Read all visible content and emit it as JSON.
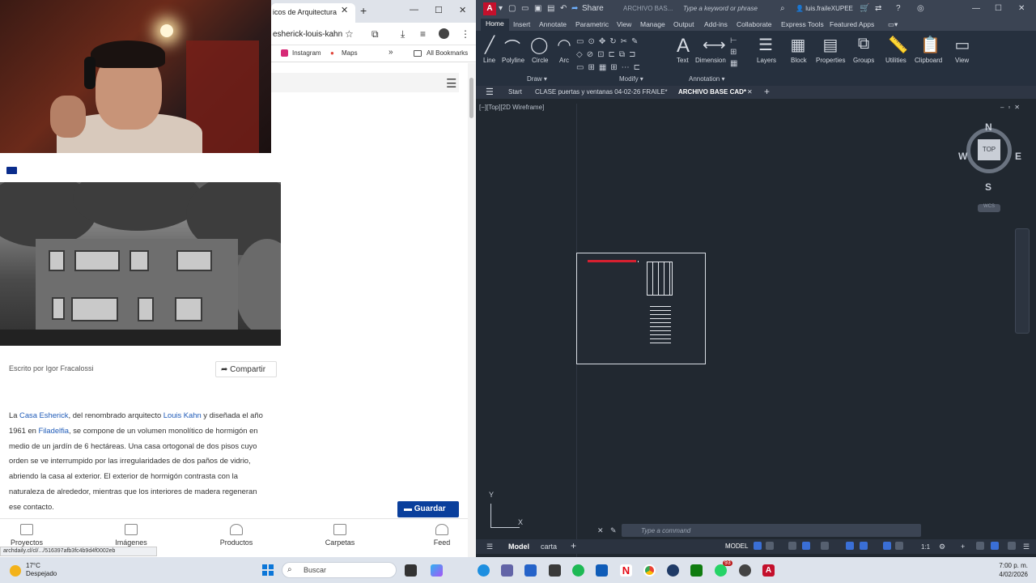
{
  "browser": {
    "tab_title": "icos de Arquitectura",
    "url_text": "esherick-louis-kahn",
    "bookmarks": {
      "instagram": "Instagram",
      "maps": "Maps",
      "all_bookmarks": "All Bookmarks"
    },
    "article": {
      "author": "Escrito por Igor Fracalossi",
      "share_label": "Compartir",
      "paragraph_parts": [
        "La ",
        "Casa Esherick",
        ", del renombrado arquitecto ",
        "Louis Kahn",
        " y diseñada el año 1961 en ",
        "Filadelfia",
        ", se compone de un volumen monolítico de hormigón en medio de un jardín de 6 hectáreas. Una casa ortogonal de dos pisos cuyo orden se ve interrumpido por las irregularidades de dos paños de vidrio, abriendo la casa al exterior. El exterior de hormigón contrasta con la naturaleza de alrededor, mientras que los interiores de madera regeneran ese contacto."
      ],
      "save_label": "Guardar"
    },
    "bottom_nav": [
      "Proyectos",
      "Imágenes",
      "Productos",
      "Carpetas",
      "Feed"
    ],
    "status_url": "archdaily.cl/cl/.../516397afb3fc4b9d4f0002eb"
  },
  "autocad": {
    "app_letter": "A",
    "share_label": "Share",
    "title": "ARCHIVO BAS...",
    "search_placeholder": "Type a keyword or phrase",
    "user": "luis.fraileXUPEE",
    "menu_tabs": [
      "Home",
      "Insert",
      "Annotate",
      "Parametric",
      "View",
      "Manage",
      "Output",
      "Add-ins",
      "Collaborate",
      "Express Tools",
      "Featured Apps"
    ],
    "ribbon_tools": {
      "line": "Line",
      "polyline": "Polyline",
      "circle": "Circle",
      "arc": "Arc",
      "text": "Text",
      "dimension": "Dimension",
      "layers": "Layers",
      "block": "Block",
      "properties": "Properties",
      "groups": "Groups",
      "utilities": "Utilities",
      "clipboard": "Clipboard",
      "view": "View"
    },
    "ribbon_groups": {
      "draw": "Draw ▾",
      "modify": "Modify ▾",
      "annotation": "Annotation ▾"
    },
    "file_tabs": {
      "start": "Start",
      "clase": "CLASE puertas y ventanas 04-02-26 FRAILE*",
      "archivo": "ARCHIVO BASE CAD*"
    },
    "view_label": "[−][Top][2D Wireframe]",
    "viewcube": {
      "n": "N",
      "s": "S",
      "e": "E",
      "w": "W",
      "top": "TOP",
      "wcs": "WCS"
    },
    "ucs": {
      "x": "X",
      "y": "Y"
    },
    "command_placeholder": "Type a command",
    "layout_tabs": {
      "model": "Model",
      "carta": "carta"
    },
    "status": {
      "model": "MODEL",
      "scale": "1:1"
    }
  },
  "taskbar": {
    "temperature": "17°C",
    "weather": "Despejado",
    "search": "Buscar",
    "time": "7:00 p. m.",
    "date": "4/02/2026",
    "badge": "93"
  },
  "colors": {
    "autocad_bg": "#212830",
    "autocad_red": "#c4102c",
    "archdaily_blue": "#0a3f9c",
    "link_blue": "#1f5bb8"
  }
}
